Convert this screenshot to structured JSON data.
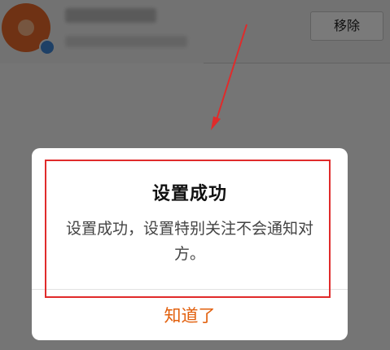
{
  "background": {
    "remove_button_label": "移除"
  },
  "dialog": {
    "title": "设置成功",
    "message": "设置成功，设置特别关注不会通知对方。",
    "confirm_label": "知道了"
  },
  "colors": {
    "accent": "#e2600d",
    "annotation": "#e02b2b",
    "avatar": "#e8692a"
  }
}
